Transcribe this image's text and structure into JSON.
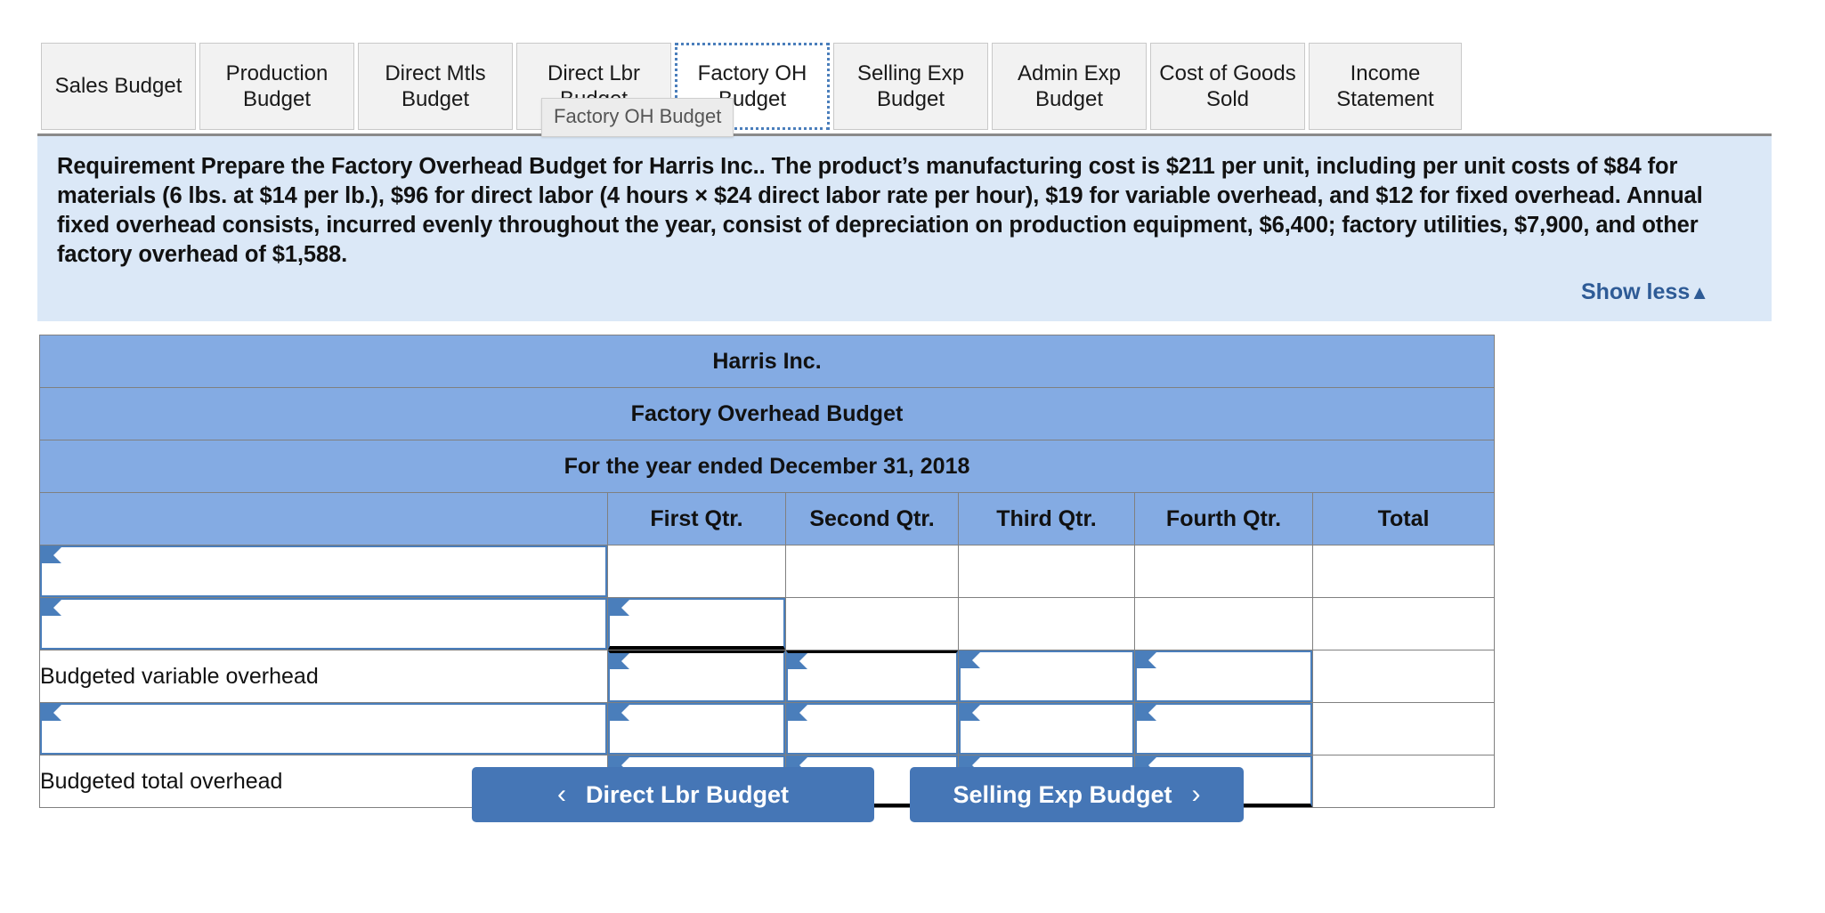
{
  "tabs": [
    {
      "id": "sales-budget",
      "label": "Sales Budget",
      "active": false
    },
    {
      "id": "production-budget",
      "label": "Production Budget",
      "active": false
    },
    {
      "id": "direct-mtls-budget",
      "label": "Direct Mtls Budget",
      "active": false
    },
    {
      "id": "direct-lbr-budget",
      "label": "Direct Lbr Budget",
      "active": false
    },
    {
      "id": "factory-oh-budget",
      "label": "Factory OH Budget",
      "active": true
    },
    {
      "id": "selling-exp-budget",
      "label": "Selling Exp Budget",
      "active": false
    },
    {
      "id": "admin-exp-budget",
      "label": "Admin Exp Budget",
      "active": false
    },
    {
      "id": "cost-of-goods-sold",
      "label": "Cost of Goods Sold",
      "active": false
    },
    {
      "id": "income-statement",
      "label": "Income Statement",
      "active": false
    }
  ],
  "tooltip": {
    "text": "Factory OH Budget"
  },
  "requirement": {
    "text": "Requirement  Prepare the Factory Overhead Budget for Harris Inc..  The product’s manufacturing cost is $211 per unit, including per unit costs of $84 for materials  (6 lbs. at $14 per lb.), $96 for direct labor (4 hours × $24 direct labor rate per hour), $19 for variable overhead, and $12 for fixed overhead. Annual fixed overhead consists, incurred evenly throughout the year, consist of depreciation on production equipment, $6,400; factory utilities, $7,900, and other factory overhead of $1,588.",
    "show_less_label": "Show less",
    "show_less_caret": "▲",
    "panel_color": "#dbe8f7",
    "link_color": "#2e5b96"
  },
  "budget_table": {
    "company": "Harris Inc.",
    "title": "Factory Overhead Budget",
    "period": "For the year ended December 31, 2018",
    "header_color": "#84abe3",
    "columns": [
      "",
      "First Qtr.",
      "Second Qtr.",
      "Third Qtr.",
      "Fourth Qtr.",
      "Total"
    ],
    "rows": [
      {
        "label": "",
        "label_is_input": true,
        "cells": [
          {
            "input": false,
            "value": ""
          },
          {
            "input": false,
            "value": ""
          },
          {
            "input": false,
            "value": ""
          },
          {
            "input": false,
            "value": ""
          },
          {
            "input": false,
            "value": ""
          }
        ]
      },
      {
        "label": "",
        "label_is_input": true,
        "cells": [
          {
            "input": true,
            "value": ""
          },
          {
            "input": false,
            "value": ""
          },
          {
            "input": false,
            "value": ""
          },
          {
            "input": false,
            "value": ""
          },
          {
            "input": false,
            "value": ""
          }
        ]
      },
      {
        "label": "Budgeted variable overhead",
        "label_is_input": false,
        "cells": [
          {
            "input": true,
            "value": ""
          },
          {
            "input": true,
            "value": ""
          },
          {
            "input": true,
            "value": ""
          },
          {
            "input": true,
            "value": ""
          },
          {
            "input": false,
            "value": ""
          }
        ]
      },
      {
        "label": "",
        "label_is_input": true,
        "cells": [
          {
            "input": true,
            "value": ""
          },
          {
            "input": true,
            "value": ""
          },
          {
            "input": true,
            "value": ""
          },
          {
            "input": true,
            "value": ""
          },
          {
            "input": false,
            "value": ""
          }
        ]
      },
      {
        "label": "Budgeted total overhead",
        "label_is_input": false,
        "cells": [
          {
            "input": true,
            "value": ""
          },
          {
            "input": true,
            "value": ""
          },
          {
            "input": true,
            "value": ""
          },
          {
            "input": true,
            "value": ""
          },
          {
            "input": false,
            "value": ""
          }
        ]
      }
    ]
  },
  "navigation": {
    "prev_label": "Direct Lbr Budget",
    "prev_chevron": "‹",
    "next_label": "Selling Exp Budget",
    "next_chevron": "›",
    "button_color": "#4576b6"
  }
}
